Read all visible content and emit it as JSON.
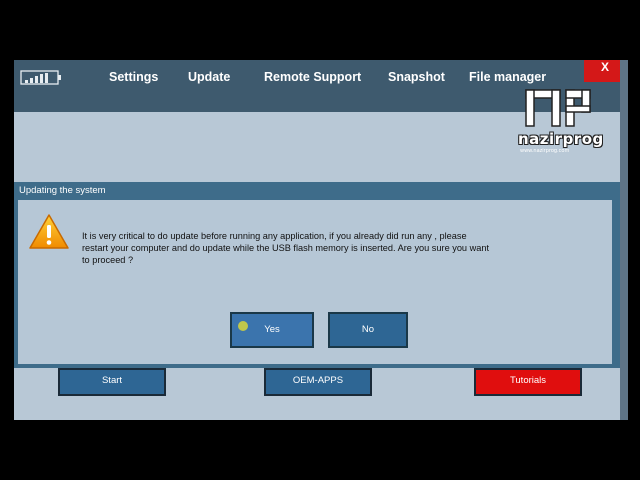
{
  "menubar": {
    "items": [
      "Settings",
      "Update",
      "Remote Support",
      "Snapshot",
      "File manager"
    ],
    "close_label": "X"
  },
  "watermark": {
    "logo_letters": "NP",
    "brand": "nazirprog",
    "site": "www.nazirprog.com"
  },
  "dialog": {
    "title": "Updating the system",
    "message": "It is very critical to do update before running any application, if you already did run any , please restart your computer and do update while the USB flash memory is inserted. Are you sure you want to proceed ?",
    "yes_label": "Yes",
    "no_label": "No"
  },
  "bottom_buttons": {
    "start": "Start",
    "oem": "OEM-APPS",
    "tutorials": "Tutorials"
  },
  "colors": {
    "menubar": "#3e5a6e",
    "background": "#b8c8d6",
    "dialog_frame": "#3e6c8a",
    "button_blue": "#2e6694",
    "button_red": "#e00e0e",
    "close_red": "#d41818"
  },
  "icons": {
    "signal": "battery-signal-icon",
    "warning": "warning-icon"
  }
}
